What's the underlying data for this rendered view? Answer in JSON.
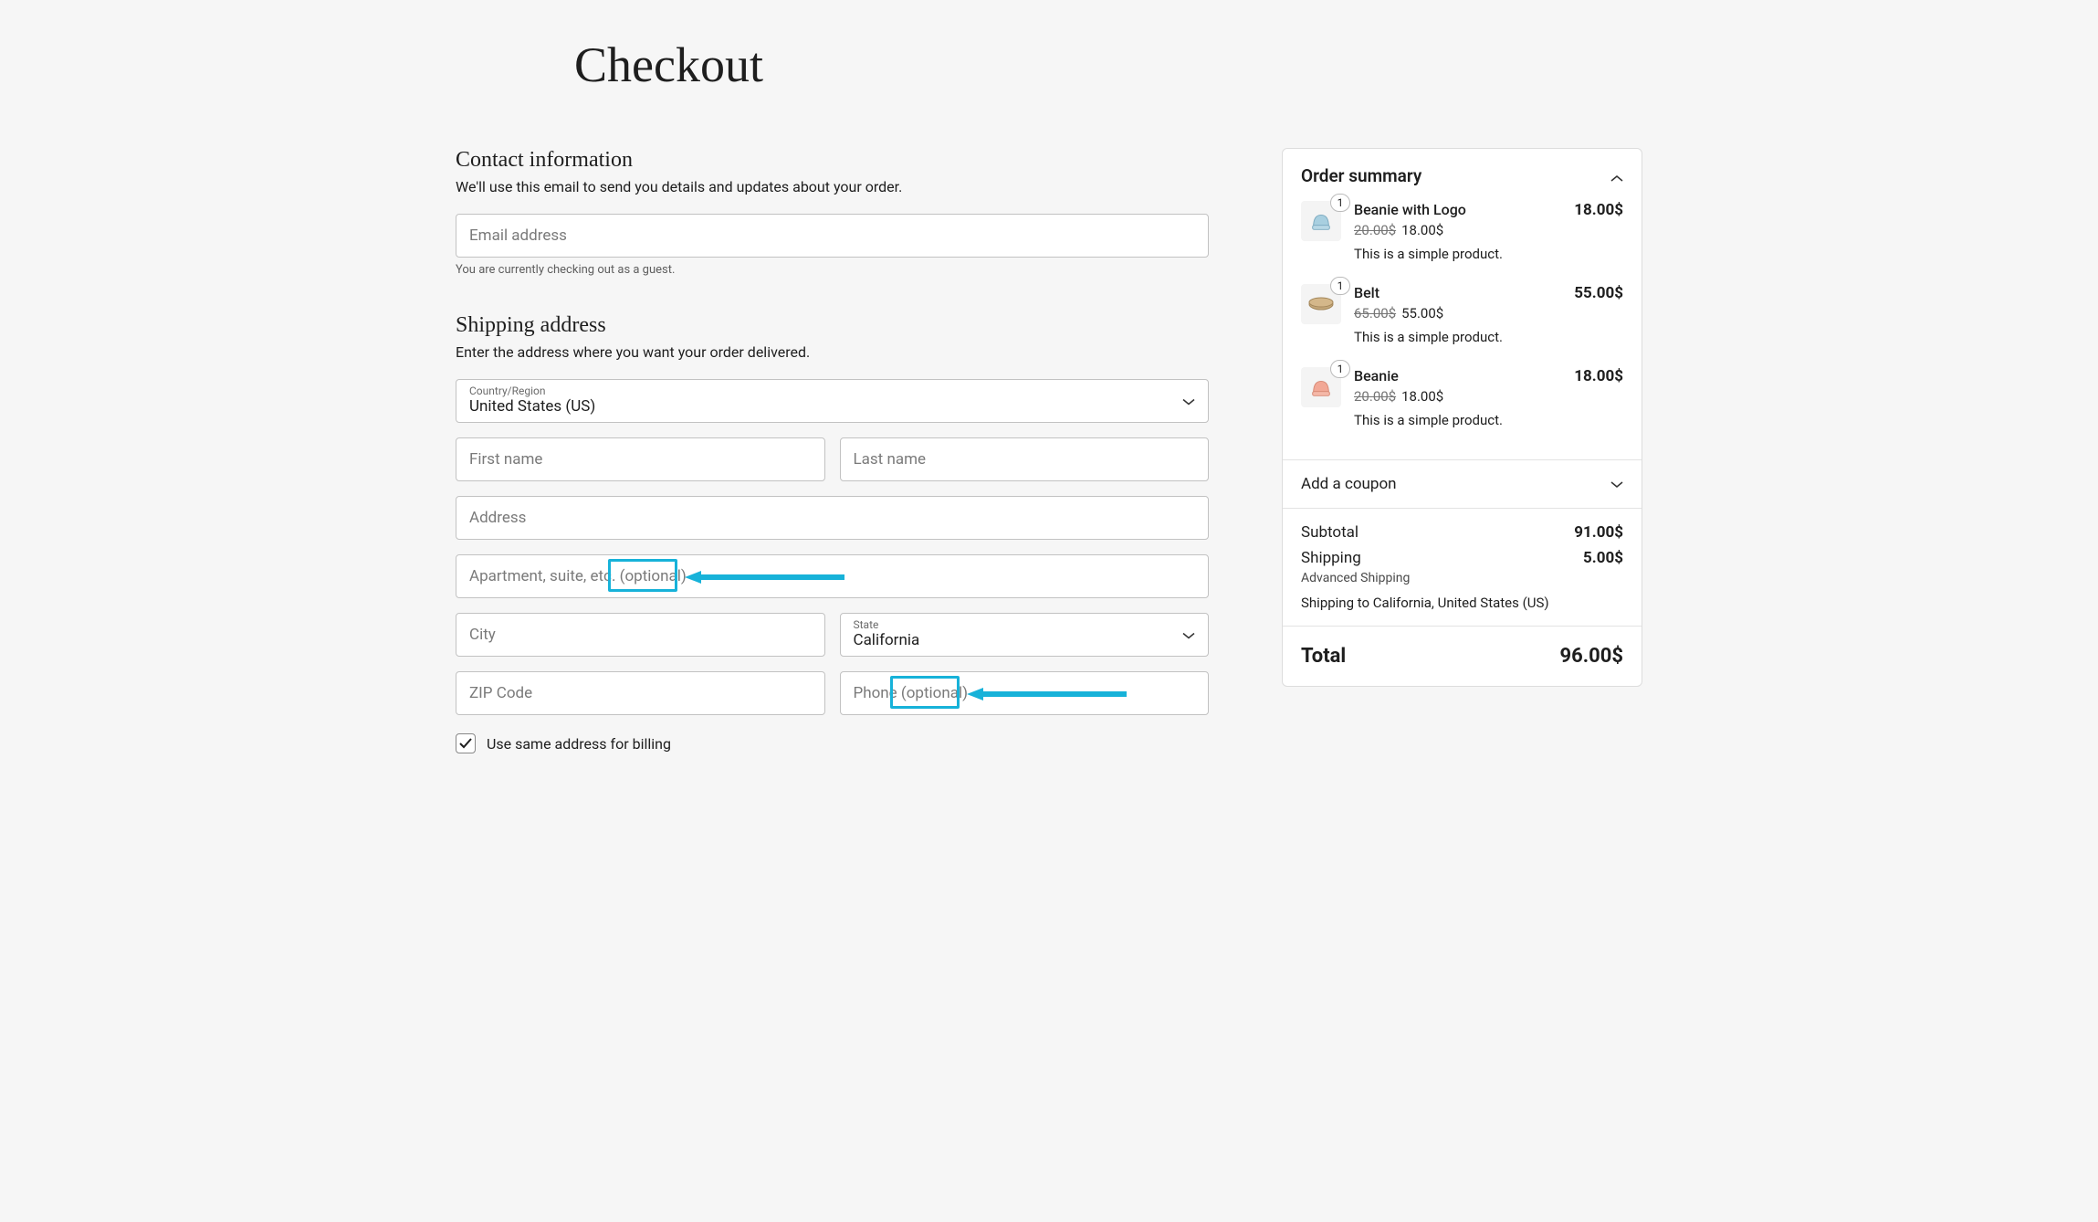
{
  "page_title": "Checkout",
  "contact": {
    "title": "Contact information",
    "desc": "We'll use this email to send you details and updates about your order.",
    "email_placeholder": "Email address",
    "guest_note": "You are currently checking out as a guest."
  },
  "shipping": {
    "title": "Shipping address",
    "desc": "Enter the address where you want your order delivered.",
    "country_label": "Country/Region",
    "country_value": "United States (US)",
    "first_name": "First name",
    "last_name": "Last name",
    "address": "Address",
    "apt_main": "Apartment, suite, etc. ",
    "apt_optional": "(optional)",
    "city": "City",
    "state_label": "State",
    "state_value": "California",
    "zip": "ZIP Code",
    "phone_main": "Phone ",
    "phone_optional": "(optional)",
    "same_billing": "Use same address for billing"
  },
  "summary": {
    "title": "Order summary",
    "items": [
      {
        "qty": "1",
        "name": "Beanie with Logo",
        "old_price": "20.00$",
        "new_price": "18.00$",
        "desc": "This is a simple product.",
        "total": "18.00$"
      },
      {
        "qty": "1",
        "name": "Belt",
        "old_price": "65.00$",
        "new_price": "55.00$",
        "desc": "This is a simple product.",
        "total": "55.00$"
      },
      {
        "qty": "1",
        "name": "Beanie",
        "old_price": "20.00$",
        "new_price": "18.00$",
        "desc": "This is a simple product.",
        "total": "18.00$"
      }
    ],
    "coupon": "Add a coupon",
    "subtotal_label": "Subtotal",
    "subtotal": "91.00$",
    "shipping_label": "Shipping",
    "shipping": "5.00$",
    "shipping_method": "Advanced Shipping",
    "shipping_to": "Shipping to California, United States (US)",
    "total_label": "Total",
    "total": "96.00$"
  }
}
